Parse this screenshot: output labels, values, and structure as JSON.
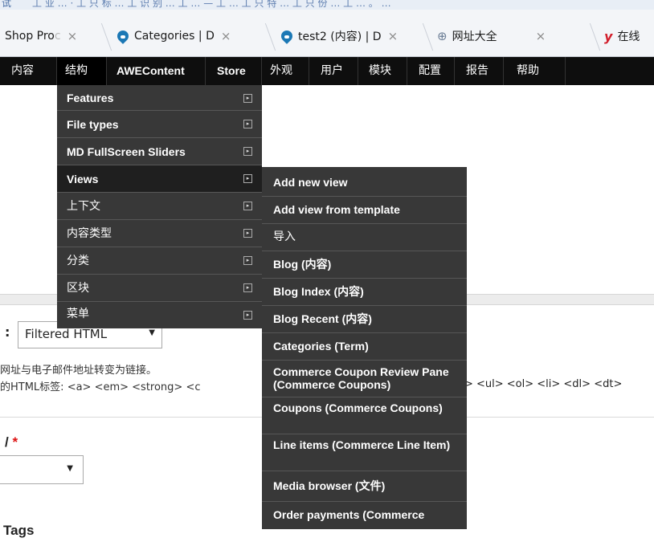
{
  "browser": {
    "top_partial_text": [
      "试",
      "工 业 …  ·  工 只 标 …  工 识 别 …  工 …  —  工 …  工 只 特 …  工 只 份 …  工 … 。  …"
    ],
    "tabs": [
      {
        "label": "Shop Pro",
        "close": "×"
      },
      {
        "label": "Categories | D",
        "close": "×"
      },
      {
        "label": "test2 (内容) | D",
        "close": "×"
      },
      {
        "label": "网址大全",
        "close": "×"
      },
      {
        "label": "在线",
        "close": ""
      }
    ]
  },
  "nav": {
    "items": [
      "内容",
      "结构",
      "AWEContent",
      "Store",
      "外观",
      "用户",
      "模块",
      "配置",
      "报告",
      "帮助"
    ]
  },
  "structure_menu": {
    "items": [
      {
        "label": "Features"
      },
      {
        "label": "File types"
      },
      {
        "label": "MD FullScreen Sliders"
      },
      {
        "label": "Views"
      },
      {
        "label": "上下文"
      },
      {
        "label": "内容类型"
      },
      {
        "label": "分类"
      },
      {
        "label": "区块"
      },
      {
        "label": "菜单"
      }
    ],
    "arrow_glyph": "▸"
  },
  "views_menu": {
    "items": [
      "Add new view",
      "Add view from template",
      "导入",
      "Blog (内容)",
      "Blog Index (内容)",
      "Blog Recent (内容)",
      "Categories (Term)",
      "Commerce Coupon Review Pane (Commerce Coupons)",
      "Coupons (Commerce Coupons)",
      "Line items (Commerce Line Item)",
      "Media browser (文件)",
      "Order payments (Commerce"
    ]
  },
  "page": {
    "format_label_partial": ":",
    "text_format_value": "Filtered HTML",
    "tip_line1": "网址与电子邮件地址转变为链接。",
    "tip_line2_prefix": "的HTML标签: <a> <em> <strong> <c",
    "tip_line2_suffix": "> <ul> <ol> <li> <dl> <dt>",
    "field_label_partial": "/",
    "required_mark": "*",
    "select_caret": "▼",
    "tags_label_partial": "Tags"
  }
}
